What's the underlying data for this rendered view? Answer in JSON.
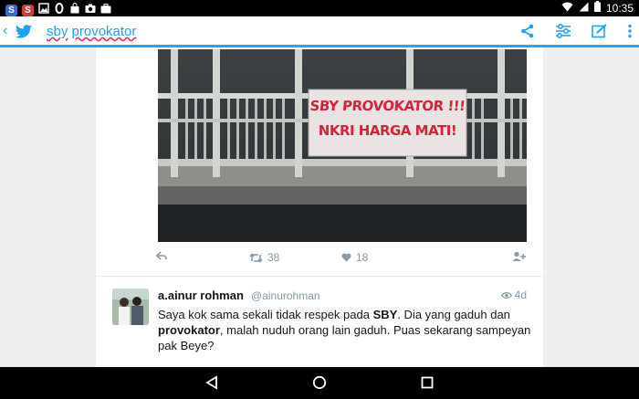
{
  "status_bar": {
    "time": "10:35",
    "icons": [
      "s-icon",
      "s-icon-red",
      "image-icon",
      "o-icon",
      "shopping-bag-icon",
      "camera-icon",
      "briefcase-icon",
      "wifi-icon",
      "signal-icon",
      "battery-icon"
    ]
  },
  "app_bar": {
    "query_word_1": "sby",
    "query_word_2": "provokator",
    "accent": "#1da1f2"
  },
  "tweet1": {
    "banner_line_1": "SBY PROVOKATOR !!!",
    "banner_line_2": "NKRI HARGA MATI!",
    "retweets": "38",
    "likes": "18"
  },
  "tweet2": {
    "name": "a.ainur rohman",
    "handle": "@ainurohman",
    "time": "4d",
    "text_parts": [
      "Saya kok sama sekali tidak respek pada ",
      "SBY",
      ". Dia yang gaduh dan ",
      "provokator",
      ", malah nuduh orang lain gaduh. Puas sekarang sampeyan pak Beye?"
    ]
  }
}
